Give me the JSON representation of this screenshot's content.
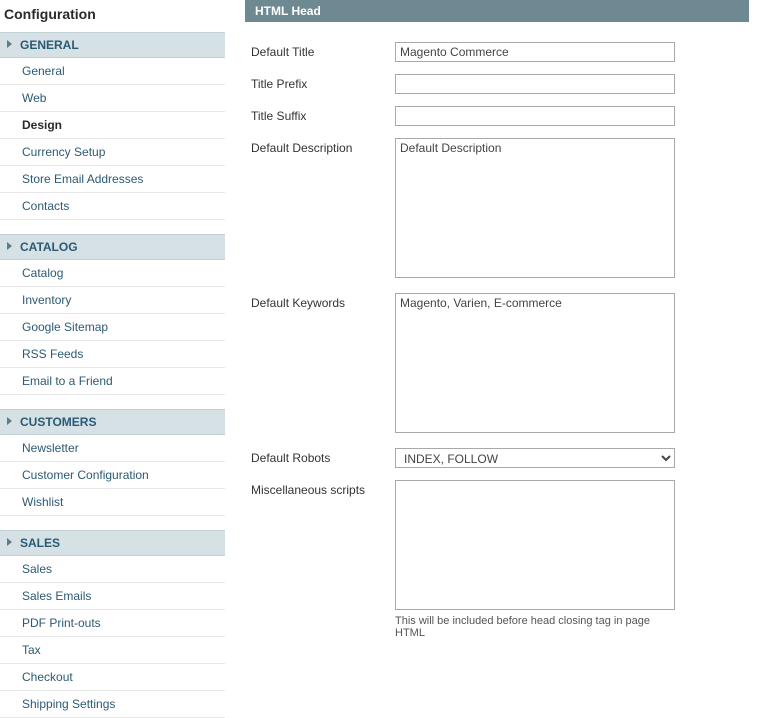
{
  "sidebar": {
    "title": "Configuration",
    "sections": [
      {
        "label": "GENERAL",
        "items": [
          "General",
          "Web",
          "Design",
          "Currency Setup",
          "Store Email Addresses",
          "Contacts"
        ],
        "activeIndex": 2
      },
      {
        "label": "CATALOG",
        "items": [
          "Catalog",
          "Inventory",
          "Google Sitemap",
          "RSS Feeds",
          "Email to a Friend"
        ]
      },
      {
        "label": "CUSTOMERS",
        "items": [
          "Newsletter",
          "Customer Configuration",
          "Wishlist"
        ]
      },
      {
        "label": "SALES",
        "items": [
          "Sales",
          "Sales Emails",
          "PDF Print-outs",
          "Tax",
          "Checkout",
          "Shipping Settings"
        ]
      }
    ]
  },
  "panel": {
    "title": "HTML Head",
    "fields": {
      "default_title": {
        "label": "Default Title",
        "value": "Magento Commerce"
      },
      "title_prefix": {
        "label": "Title Prefix",
        "value": ""
      },
      "title_suffix": {
        "label": "Title Suffix",
        "value": ""
      },
      "default_description": {
        "label": "Default Description",
        "value": "Default Description"
      },
      "default_keywords": {
        "label": "Default Keywords",
        "value": "Magento, Varien, E-commerce"
      },
      "default_robots": {
        "label": "Default Robots",
        "selected": "INDEX, FOLLOW"
      },
      "misc_scripts": {
        "label": "Miscellaneous scripts",
        "value": "",
        "help": "This will be included before head closing tag in page HTML"
      }
    }
  }
}
